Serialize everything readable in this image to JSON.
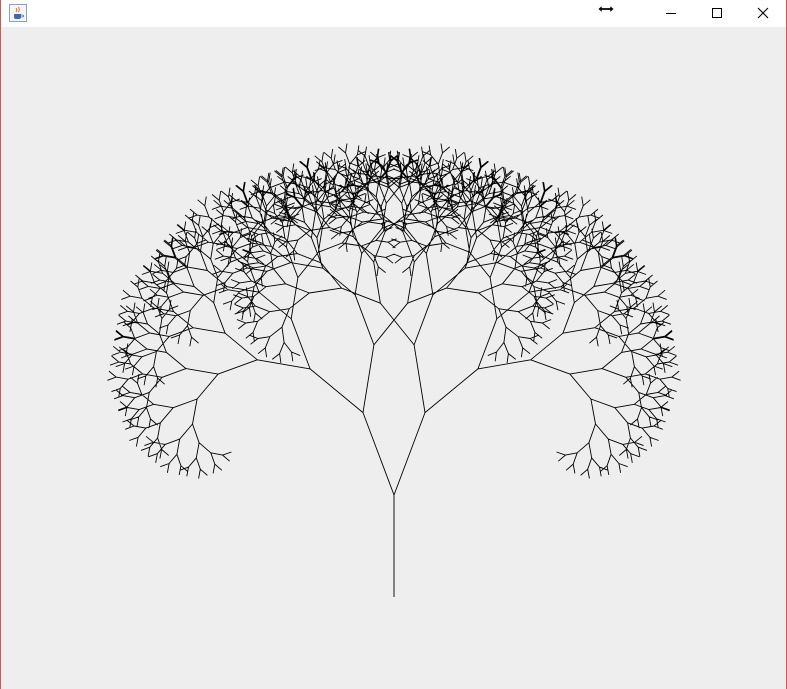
{
  "window": {
    "title": "",
    "icons": {
      "app": "java-cup-icon",
      "cursor": "horizontal-resize-cursor-icon",
      "minimize": "minimize-icon",
      "maximize": "maximize-icon",
      "close": "close-icon"
    }
  },
  "canvas": {
    "background": "#eeeeee",
    "stroke_color": "#000000",
    "figure": "fractal-tree"
  }
}
